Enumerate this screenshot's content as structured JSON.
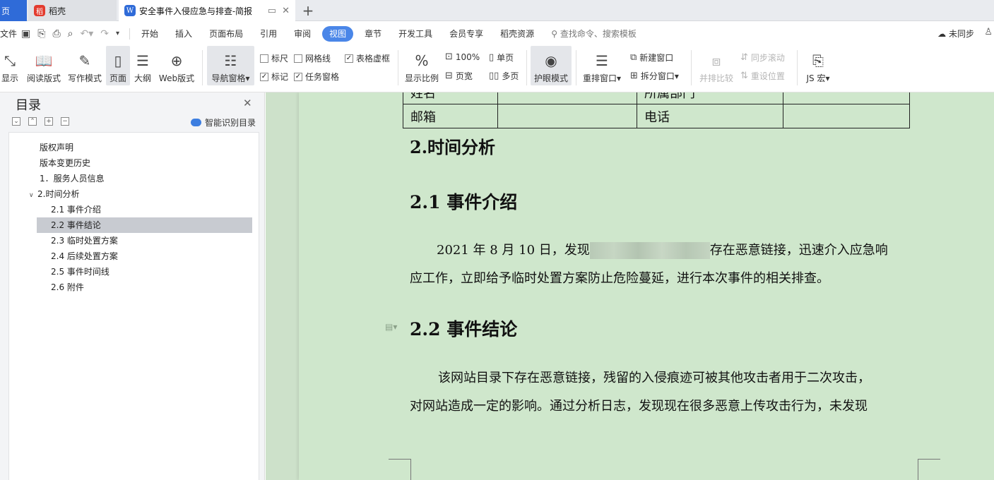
{
  "tabs": [
    {
      "label": "页"
    },
    {
      "label": "稻壳",
      "logo": "稻"
    },
    {
      "label": "安全事件入侵应急与排查-简报",
      "logo": "W"
    }
  ],
  "menu": {
    "file": "文件",
    "items": [
      "开始",
      "插入",
      "页面布局",
      "引用",
      "审阅",
      "视图",
      "章节",
      "开发工具",
      "会员专享",
      "稻壳资源"
    ],
    "active": "视图",
    "search": "查找命令、搜索模板",
    "sync": "未同步"
  },
  "ribbon": {
    "show": "显示",
    "read": "阅读版式",
    "write": "写作模式",
    "page": "页面",
    "outline": "大纲",
    "web": "Web版式",
    "nav": "导航窗格",
    "ruler": "标尺",
    "gridline": "网格线",
    "tableframe": "表格虚框",
    "marks": "标记",
    "taskpane": "任务窗格",
    "zoom": "显示比例",
    "zoom100": "100%",
    "pagewidth": "页宽",
    "single": "单页",
    "multi": "多页",
    "eyecare": "护眼模式",
    "rearrange": "重排窗口",
    "newwin": "新建窗口",
    "splitwin": "拆分窗口",
    "compare": "并排比较",
    "syncscroll": "同步滚动",
    "resetpos": "重设位置",
    "jsmacro": "JS 宏"
  },
  "nav": {
    "title": "目录",
    "smart": "智能识别目录",
    "items": [
      {
        "label": "版权声明"
      },
      {
        "label": "版本变更历史"
      },
      {
        "label": "1．服务人员信息"
      },
      {
        "label": "2.时间分析"
      },
      {
        "label": "2.1 事件介绍"
      },
      {
        "label": "2.2 事件结论"
      },
      {
        "label": "2.3 临时处置方案"
      },
      {
        "label": "2.4 后续处置方案"
      },
      {
        "label": "2.5 事件时间线"
      },
      {
        "label": "2.6 附件"
      }
    ]
  },
  "doc": {
    "table": [
      [
        "姓名",
        "",
        "所属部门",
        ""
      ],
      [
        "邮箱",
        "",
        "电话",
        ""
      ]
    ],
    "h_time": "2.时间分析",
    "h_intro": "2.1 事件介绍",
    "intro_a": "2021 年 8 月 10 日，发现",
    "intro_b": "存在恶意链接，迅速介入应急响",
    "intro_c": "应工作，立即给予临时处置方案防止危险蔓延，进行本次事件的相关排查。",
    "h_concl": "2.2 事件结论",
    "concl_a": "该网站目录下存在恶意链接，残留的入侵痕迹可被其他攻击者用于二次攻击，",
    "concl_b": "对网站造成一定的影响。通过分析日志，发现现在很多恶意上传攻击行为，未发现"
  }
}
